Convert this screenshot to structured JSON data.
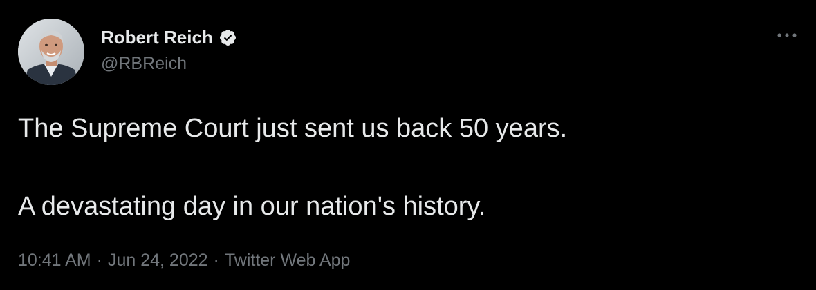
{
  "author": {
    "display_name": "Robert Reich",
    "handle": "@RBReich",
    "verified_icon": "verified-badge-icon"
  },
  "tweet": {
    "lines": [
      "The Supreme Court just sent us back 50 years.",
      "A devastating day in our nation's history."
    ]
  },
  "meta": {
    "time": "10:41 AM",
    "separator": "·",
    "date": "Jun 24, 2022",
    "source": "Twitter Web App"
  },
  "icons": {
    "more": "more-options-icon",
    "avatar": "avatar"
  },
  "colors": {
    "background": "#000000",
    "primary_text": "#e7e9ea",
    "secondary_text": "#71767b",
    "verified": "#e7e9ea"
  }
}
